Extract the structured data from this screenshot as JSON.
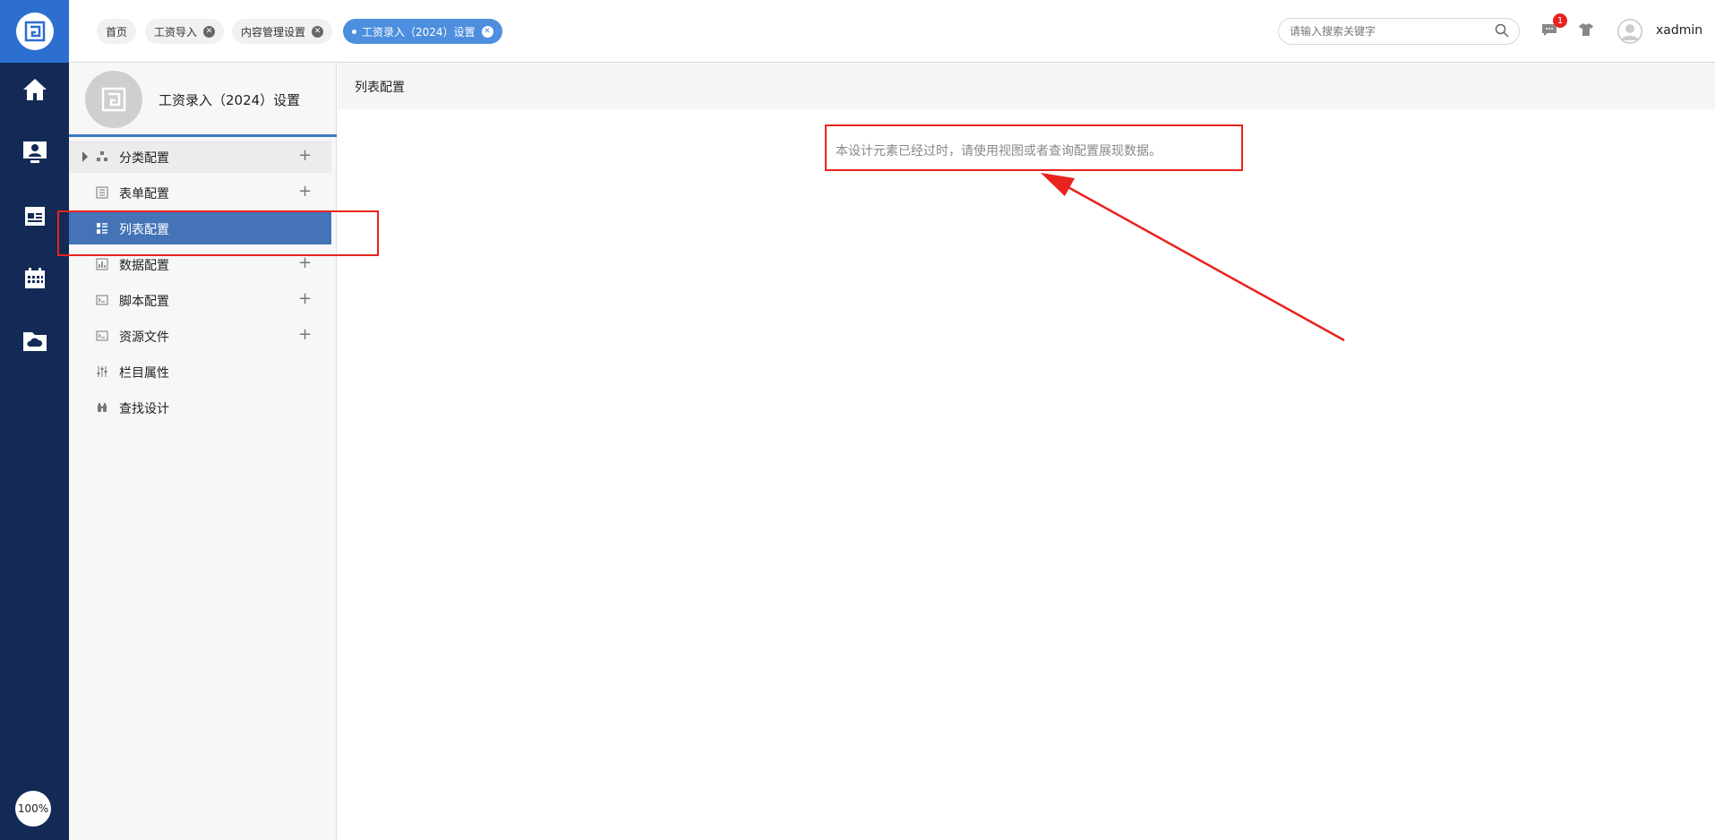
{
  "rail": {
    "zoom": "100%",
    "colors": {
      "rail_bg": "#122a55",
      "logo_bg": "#2c6fd0"
    },
    "icons": [
      "home-icon",
      "user-desktop-icon",
      "news-icon",
      "calendar-icon",
      "cloud-folder-icon"
    ]
  },
  "tabs": [
    {
      "label": "首页",
      "closable": false
    },
    {
      "label": "工资导入",
      "closable": true
    },
    {
      "label": "内容管理设置",
      "closable": true
    },
    {
      "label": "工资录入（2024）设置",
      "closable": true,
      "active": true
    }
  ],
  "header": {
    "search_placeholder": "请输入搜索关键字",
    "notification_count": "1",
    "username": "xadmin"
  },
  "sidebar": {
    "title": "工资录入（2024）设置",
    "items": [
      {
        "label": "分类配置",
        "icon": "category-icon",
        "plus": "+"
      },
      {
        "label": "表单配置",
        "icon": "form-icon",
        "plus": "+"
      },
      {
        "label": "列表配置",
        "icon": "list-icon",
        "active": true
      },
      {
        "label": "数据配置",
        "icon": "chart-icon",
        "plus": "+"
      },
      {
        "label": "脚本配置",
        "icon": "terminal-icon",
        "plus": "+"
      },
      {
        "label": "资源文件",
        "icon": "terminal-icon",
        "plus": "+"
      },
      {
        "label": "栏目属性",
        "icon": "sliders-icon"
      },
      {
        "label": "查找设计",
        "icon": "binoculars-icon"
      }
    ]
  },
  "main": {
    "title": "列表配置",
    "message": "本设计元素已经过时，请使用视图或者查询配置展现数据。"
  },
  "colors": {
    "accent": "#4473b8",
    "tab_active": "#4d8fde",
    "annotation": "#e8231e",
    "badge": "#e52222"
  }
}
